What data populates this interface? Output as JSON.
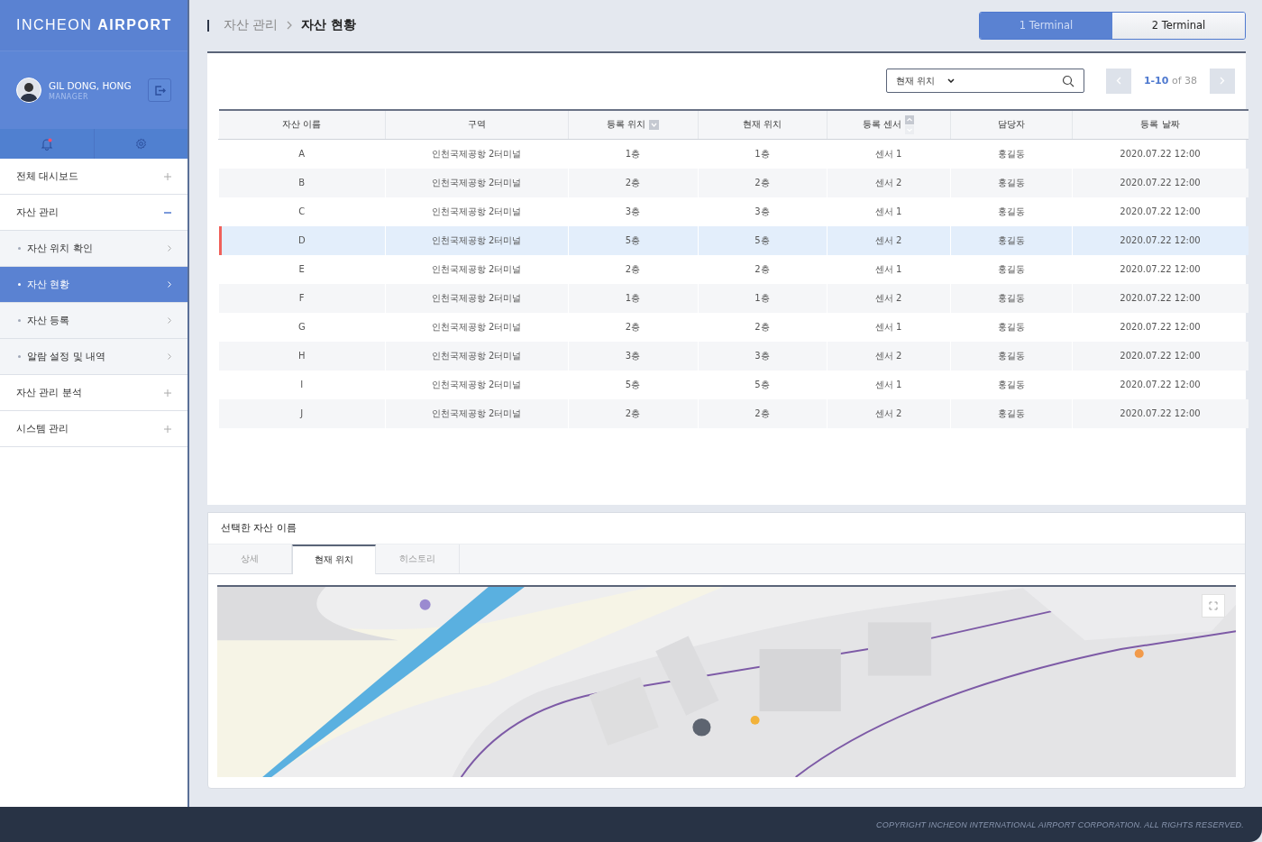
{
  "logo": {
    "light": "INCHEON",
    "bold": "AIRPORT"
  },
  "user": {
    "name": "GIL DONG, HONG",
    "role": "MANAGER"
  },
  "notifications": {
    "unread": true
  },
  "sidebar": {
    "items": [
      {
        "label": "전체 대시보드",
        "expanded": false,
        "selected": false
      },
      {
        "label": "자산 관리",
        "expanded": true,
        "selected": false,
        "children": [
          {
            "label": "자산 위치 확인",
            "selected": false
          },
          {
            "label": "자산 현황",
            "selected": true
          },
          {
            "label": "자산 등록",
            "selected": false
          },
          {
            "label": "알람 설정 및 내역",
            "selected": false
          }
        ]
      },
      {
        "label": "자산 관리 분석",
        "expanded": false,
        "selected": false
      },
      {
        "label": "시스템 관리",
        "expanded": false,
        "selected": false
      }
    ]
  },
  "breadcrumb": [
    "자산 관리",
    "자산 현황"
  ],
  "terminal_tabs": [
    {
      "label": "1 Terminal",
      "selected": true
    },
    {
      "label": "2 Terminal",
      "selected": false
    }
  ],
  "search": {
    "value": "현재 위치"
  },
  "pager": {
    "range": "1-10",
    "total": "of 38"
  },
  "table": {
    "columns": [
      {
        "label": "자산 이름",
        "kind": "plain"
      },
      {
        "label": "구역",
        "kind": "plain"
      },
      {
        "label": "등록 위치",
        "kind": "dropdown"
      },
      {
        "label": "현재 위치",
        "kind": "plain"
      },
      {
        "label": "등록 센서",
        "kind": "sorter"
      },
      {
        "label": "담당자",
        "kind": "plain"
      },
      {
        "label": "등록 날짜",
        "kind": "plain"
      }
    ],
    "rows": [
      {
        "selected": false,
        "cells": [
          "A",
          "인천국제공항 2터미널",
          "1층",
          "1층",
          "센서 1",
          "홍길동",
          "2020.07.22 12:00"
        ]
      },
      {
        "selected": false,
        "cells": [
          "B",
          "인천국제공항 2터미널",
          "2층",
          "2층",
          "센서 2",
          "홍길동",
          "2020.07.22 12:00"
        ]
      },
      {
        "selected": false,
        "cells": [
          "C",
          "인천국제공항 2터미널",
          "3층",
          "3층",
          "센서 1",
          "홍길동",
          "2020.07.22 12:00"
        ]
      },
      {
        "selected": true,
        "cells": [
          "D",
          "인천국제공항 2터미널",
          "5층",
          "5층",
          "센서 2",
          "홍길동",
          "2020.07.22 12:00"
        ]
      },
      {
        "selected": false,
        "cells": [
          "E",
          "인천국제공항 2터미널",
          "2층",
          "2층",
          "센서 1",
          "홍길동",
          "2020.07.22 12:00"
        ]
      },
      {
        "selected": false,
        "cells": [
          "F",
          "인천국제공항 2터미널",
          "1층",
          "1층",
          "센서 2",
          "홍길동",
          "2020.07.22 12:00"
        ]
      },
      {
        "selected": false,
        "cells": [
          "G",
          "인천국제공항 2터미널",
          "2층",
          "2층",
          "센서 1",
          "홍길동",
          "2020.07.22 12:00"
        ]
      },
      {
        "selected": false,
        "cells": [
          "H",
          "인천국제공항 2터미널",
          "3층",
          "3층",
          "센서 2",
          "홍길동",
          "2020.07.22 12:00"
        ]
      },
      {
        "selected": false,
        "cells": [
          "I",
          "인천국제공항 2터미널",
          "5층",
          "5층",
          "센서 1",
          "홍길동",
          "2020.07.22 12:00"
        ]
      },
      {
        "selected": false,
        "cells": [
          "J",
          "인천국제공항 2터미널",
          "2층",
          "2층",
          "센서 2",
          "홍길동",
          "2020.07.22 12:00"
        ]
      }
    ]
  },
  "detail": {
    "title": "선택한 자산 이름",
    "tabs": [
      {
        "label": "상세",
        "selected": false
      },
      {
        "label": "현재 위치",
        "selected": true
      },
      {
        "label": "히스토리",
        "selected": false
      }
    ]
  },
  "footer": "COPYRIGHT INCHEON INTERNATIONAL AIRPORT CORPORATION. ALL RIGHTS RESERVED."
}
